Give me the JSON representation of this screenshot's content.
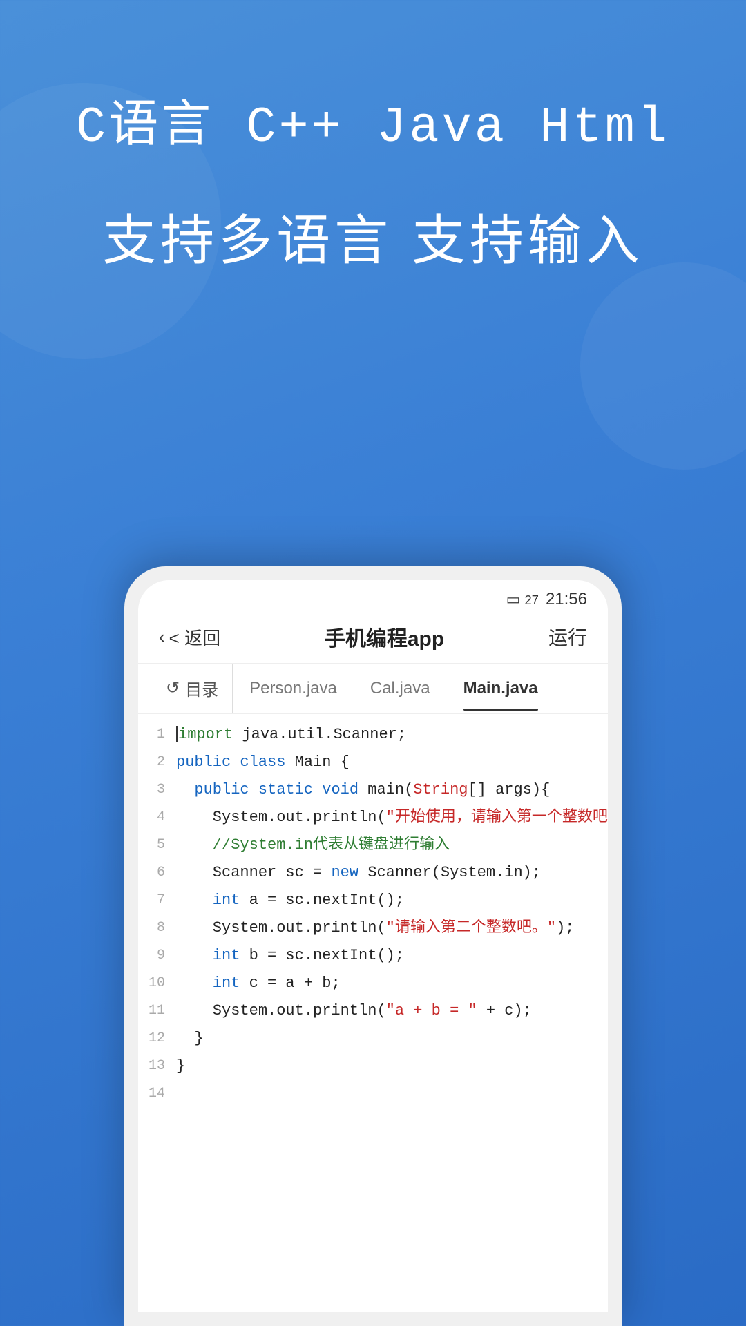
{
  "background": {
    "gradient_start": "#4a90d9",
    "gradient_end": "#2a6bc5"
  },
  "hero": {
    "title": "C语言  C++  Java  Html",
    "subtitle": "支持多语言 支持输入"
  },
  "phone": {
    "status_bar": {
      "battery": "27",
      "time": "21:56"
    },
    "nav": {
      "back_label": "< 返回",
      "title": "手机编程app",
      "run_label": "运行"
    },
    "tabs": {
      "directory_label": "目录",
      "items": [
        {
          "label": "Person.java",
          "active": false
        },
        {
          "label": "Cal.java",
          "active": false
        },
        {
          "label": "Main.java",
          "active": true
        }
      ]
    },
    "code": {
      "lines": [
        {
          "num": 1,
          "content": "import java.util.Scanner;"
        },
        {
          "num": 2,
          "content": "public class Main {"
        },
        {
          "num": 3,
          "content": "    public static void main(String[] args){"
        },
        {
          "num": 4,
          "content": "        System.out.println(\"开始使用，请输入第一个整数吧。\");"
        },
        {
          "num": 5,
          "content": "        //System.in代表从键盘进行输入"
        },
        {
          "num": 6,
          "content": "        Scanner sc = new Scanner(System.in);"
        },
        {
          "num": 7,
          "content": "        int a = sc.nextInt();"
        },
        {
          "num": 8,
          "content": "        System.out.println(\"请输入第二个整数吧。\");"
        },
        {
          "num": 9,
          "content": "        int b = sc.nextInt();"
        },
        {
          "num": 10,
          "content": "        int c = a + b;"
        },
        {
          "num": 11,
          "content": "        System.out.println(\"a + b = \" + c);"
        },
        {
          "num": 12,
          "content": "    }"
        },
        {
          "num": 13,
          "content": "}"
        },
        {
          "num": 14,
          "content": ""
        }
      ]
    }
  }
}
